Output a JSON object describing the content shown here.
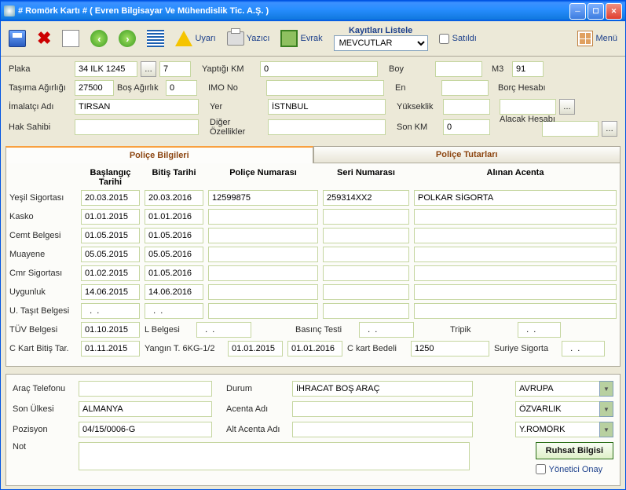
{
  "title": "# Romörk Kartı #   ( Evren Bilgisayar Ve Mühendislik Tic. A.Ş. )",
  "toolbar": {
    "uyari": "Uyarı",
    "yazici": "Yazıcı",
    "evrak": "Evrak",
    "kayitlari_listele": "Kayıtları Listele",
    "kayit_select": "MEVCUTLAR",
    "satildi": "Satıldı",
    "menu": "Menü"
  },
  "form": {
    "plaka_lbl": "Plaka",
    "plaka": "34 ILK 1245",
    "plaka2": "7",
    "yaptigi_km_lbl": "Yaptığı KM",
    "yaptigi_km": "0",
    "boy_lbl": "Boy",
    "boy": "",
    "m3_lbl": "M3",
    "m3": "91",
    "tasima_lbl": "Taşıma Ağırlığı",
    "tasima": "27500",
    "bos_lbl": "Boş Ağırlık",
    "bos": "0",
    "imo_lbl": "IMO No",
    "imo": "",
    "en_lbl": "En",
    "en": "",
    "borc_lbl": "Borç Hesabı",
    "borc": "",
    "imalatci_lbl": "İmalatçı Adı",
    "imalatci": "TIRSAN",
    "yer_lbl": "Yer",
    "yer": "İSTNBUL",
    "yukseklik_lbl": "Yükseklik",
    "yukseklik": "",
    "alacak_lbl": "Alacak Hesabı",
    "alacak": "",
    "hak_lbl": "Hak Sahibi",
    "hak": "",
    "diger_lbl": "Diğer Özellikler",
    "diger": "",
    "sonkm_lbl": "Son KM",
    "sonkm": "0"
  },
  "tabs": {
    "t1": "Poliçe Bilgileri",
    "t2": "Poliçe Tutarları"
  },
  "grid": {
    "h_baslangic": "Başlangıç Tarihi",
    "h_bitis": "Bitiş Tarihi",
    "h_police": "Poliçe Numarası",
    "h_seri": "Seri Numarası",
    "h_acenta": "Alınan Acenta",
    "rows": [
      {
        "lbl": "Yeşil Sigortası",
        "b": "20.03.2015",
        "e": "20.03.2016",
        "p": "12599875",
        "s": "259314XX2",
        "a": "POLKAR SİGORTA"
      },
      {
        "lbl": "Kasko",
        "b": "01.01.2015",
        "e": "01.01.2016",
        "p": "",
        "s": "",
        "a": ""
      },
      {
        "lbl": "Cemt Belgesi",
        "b": "01.05.2015",
        "e": "01.05.2016",
        "p": "",
        "s": "",
        "a": ""
      },
      {
        "lbl": "Muayene",
        "b": "05.05.2015",
        "e": "05.05.2016",
        "p": "",
        "s": "",
        "a": ""
      },
      {
        "lbl": "Cmr Sigortası",
        "b": "01.02.2015",
        "e": "01.05.2016",
        "p": "",
        "s": "",
        "a": ""
      },
      {
        "lbl": "Uygunluk",
        "b": "14.06.2015",
        "e": "14.06.2016",
        "p": "",
        "s": "",
        "a": ""
      },
      {
        "lbl": "U. Taşıt Belgesi",
        "b": "  .  .",
        "e": "  .  .",
        "p": "",
        "s": "",
        "a": ""
      }
    ],
    "tuv_lbl": "TÜV Belgesi",
    "tuv": "01.10.2015",
    "lbelge_lbl": "L Belgesi",
    "lbelge": "  .  .",
    "basinc_lbl": "Basınç Testi",
    "basinc": "  .  .",
    "tripik_lbl": "Tripik",
    "tripik": "  .  .",
    "ckart_lbl": "C Kart Bitiş Tar.",
    "ckart": "01.11.2015",
    "yangin_lbl": "Yangın T. 6KG-1/2",
    "yangin1": "01.01.2015",
    "yangin2": "01.01.2016",
    "ckbedel_lbl": "C kart Bedeli",
    "ckbedel": "1250",
    "suriye_lbl": "Suriye Sigorta",
    "suriye": "  .  ."
  },
  "bottom": {
    "arac_tel_lbl": "Araç Telefonu",
    "arac_tel": "",
    "durum_lbl": "Durum",
    "durum": "İHRACAT BOŞ ARAÇ",
    "c1": "AVRUPA",
    "c2": "ÖZVARLIK",
    "c3": "Y.ROMÖRK",
    "son_ulke_lbl": "Son Ülkesi",
    "son_ulke": "ALMANYA",
    "acenta_lbl": "Acenta Adı",
    "acenta": "",
    "pozisyon_lbl": "Pozisyon",
    "pozisyon": "04/15/0006-G",
    "alt_acenta_lbl": "Alt Acenta Adı",
    "alt_acenta": "",
    "ruhsat": "Ruhsat Bilgisi",
    "yonetici": "Yönetici Onay",
    "not_lbl": "Not",
    "not": ""
  }
}
